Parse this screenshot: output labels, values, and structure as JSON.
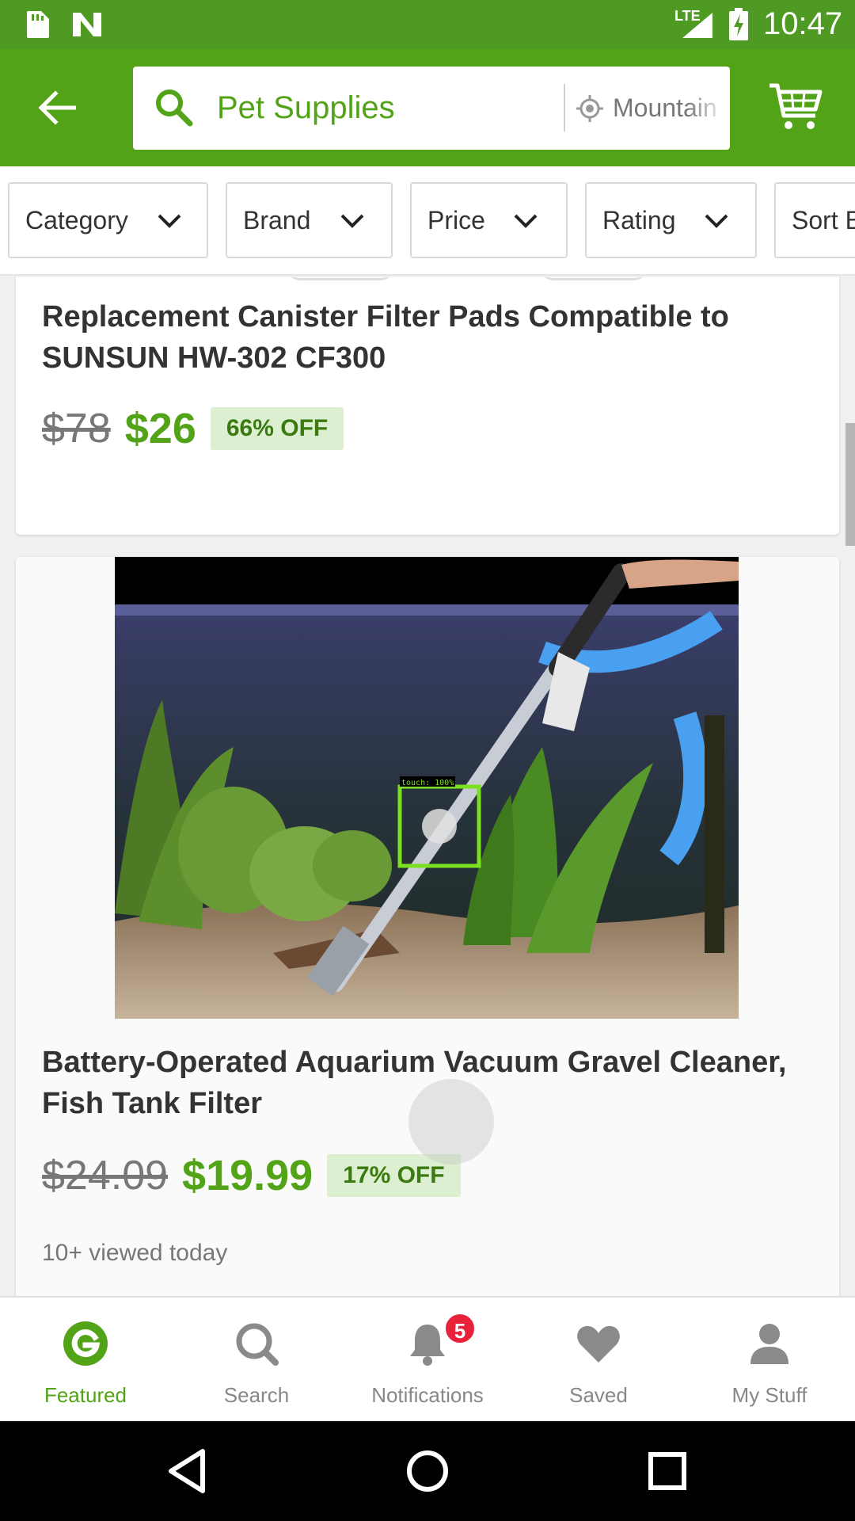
{
  "status_bar": {
    "network": "LTE",
    "time": "10:47"
  },
  "app_bar": {
    "search_query": "Pet Supplies",
    "location": "Mountain View"
  },
  "filters": [
    {
      "label": "Category"
    },
    {
      "label": "Brand"
    },
    {
      "label": "Price"
    },
    {
      "label": "Rating"
    },
    {
      "label": "Sort By"
    }
  ],
  "products": [
    {
      "title": "Replacement Canister Filter Pads Compatible to SUNSUN HW-302 CF300",
      "old_price": "$78",
      "price": "$26",
      "discount": "66% OFF"
    },
    {
      "title": "Battery-Operated Aquarium Vacuum Gravel Cleaner, Fish Tank Filter",
      "old_price": "$24.09",
      "price": "$19.99",
      "discount": "17% OFF",
      "viewed": "10+ viewed today",
      "image_overlay_label": "touch: 100%"
    }
  ],
  "bottom_nav": {
    "items": [
      {
        "label": "Featured",
        "icon": "groupon-g-icon",
        "active": true
      },
      {
        "label": "Search",
        "icon": "search-icon"
      },
      {
        "label": "Notifications",
        "icon": "bell-icon",
        "badge": "5"
      },
      {
        "label": "Saved",
        "icon": "heart-icon"
      },
      {
        "label": "My Stuff",
        "icon": "person-icon"
      }
    ]
  },
  "colors": {
    "brand_green": "#53a318",
    "status_green": "#4f9a23",
    "badge_red": "#e8223a"
  }
}
